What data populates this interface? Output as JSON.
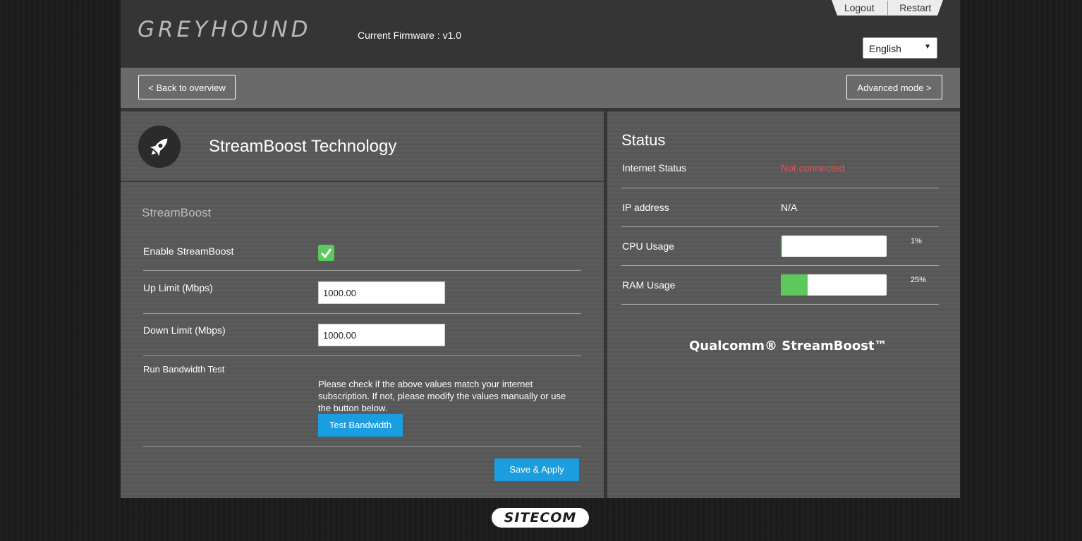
{
  "header": {
    "logo_text": "GREYHOUND",
    "firmware": "Current Firmware : v1.0",
    "logout_label": "Logout",
    "restart_label": "Restart",
    "language": "English"
  },
  "nav": {
    "back_label": "< Back to overview",
    "advanced_label": "Advanced mode >"
  },
  "streamboost_panel": {
    "title": "StreamBoost Technology",
    "section_label": "StreamBoost",
    "enable_label": "Enable StreamBoost",
    "enable_checked": true,
    "up_label": "Up Limit (Mbps)",
    "up_value": "1000.00",
    "down_label": "Down Limit (Mbps)",
    "down_value": "1000.00",
    "test_label": "Run Bandwidth Test",
    "test_hint": "Please check if the above values match your internet subscription. If not, please modify the values manually or use the button below.",
    "test_button": "Test Bandwidth",
    "save_button": "Save & Apply"
  },
  "status_panel": {
    "title": "Status",
    "internet_label": "Internet Status",
    "internet_value": "Not connected",
    "ip_label": "IP address",
    "ip_value": "N/A",
    "cpu_label": "CPU Usage",
    "cpu_percent": 1,
    "cpu_text": "1%",
    "ram_label": "RAM Usage",
    "ram_percent": 25,
    "ram_text": "25%",
    "brand": "Qualcomm® StreamBoost™"
  },
  "footer": {
    "brand": "SITECOM"
  },
  "colors": {
    "accent_blue": "#1a9ee0",
    "ok_green": "#5cc95c",
    "error_red": "#e05454"
  }
}
